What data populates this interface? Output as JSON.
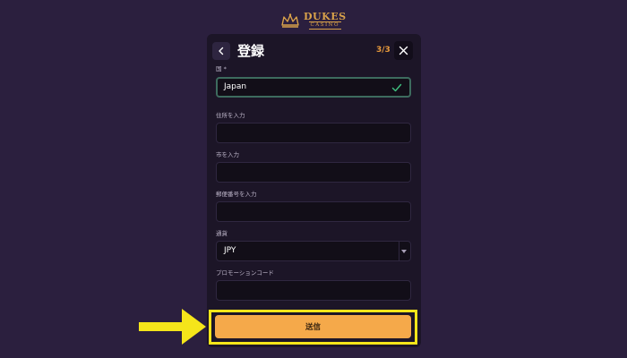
{
  "brand": {
    "name": "DUKES",
    "sub": "CASINO"
  },
  "modal": {
    "title": "登録",
    "step": "3/3"
  },
  "form": {
    "country": {
      "label": "国 *",
      "value": "Japan"
    },
    "address": {
      "label": "住所を入力",
      "value": ""
    },
    "city": {
      "label": "市を入力",
      "value": ""
    },
    "postal": {
      "label": "郵便番号を入力",
      "value": ""
    },
    "currency": {
      "label": "通貨",
      "value": "JPY"
    },
    "promo": {
      "label": "プロモーションコード",
      "value": ""
    }
  },
  "submit": {
    "label": "送信"
  },
  "colors": {
    "background": "#2b1f3e",
    "modal": "#1c1527",
    "accent": "#f5a94a",
    "highlight": "#f5e51a",
    "valid": "#3fbf7f"
  },
  "icons": [
    "crown-icon",
    "chevron-left-icon",
    "close-icon",
    "checkmark-icon",
    "caret-down-icon",
    "arrow-right-icon"
  ]
}
